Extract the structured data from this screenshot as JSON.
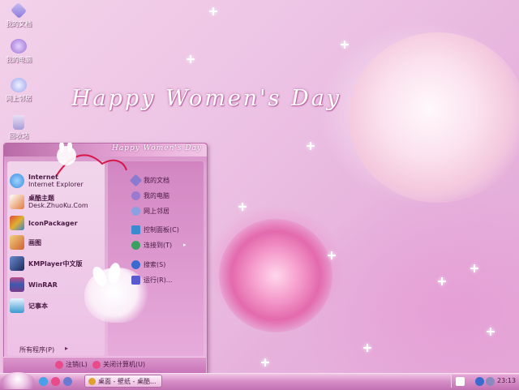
{
  "desktop": {
    "headline": "Happy Women's Day",
    "icons": [
      {
        "label": "我的文档",
        "icon": "my-documents-icon",
        "color": "#9c8ee0"
      },
      {
        "label": "我的电脑",
        "icon": "my-computer-icon",
        "color": "#b08ae0"
      },
      {
        "label": "网上邻居",
        "icon": "network-icon",
        "color": "#a9b2f2"
      },
      {
        "label": "回收站",
        "icon": "recycle-bin-icon",
        "color": "#c0b4e6"
      }
    ]
  },
  "start_menu": {
    "header_title": "Happy Women's Day",
    "left_items": [
      {
        "title": "Internet",
        "subtitle": "Internet Explorer",
        "icon": "ie-icon",
        "color": "#3a8be0"
      },
      {
        "title": "桌酷主题",
        "subtitle": "Desk.ZhuoKu.Com",
        "icon": "zhuoku-theme-icon",
        "color": "#e07a3a"
      },
      {
        "title": "IconPackager",
        "subtitle": "",
        "icon": "iconpackager-icon",
        "color": "#e0a030"
      },
      {
        "title": "画图",
        "subtitle": "",
        "icon": "paint-icon",
        "color": "#d06030"
      },
      {
        "title": "KMPlayer中文版",
        "subtitle": "",
        "icon": "kmplayer-icon",
        "color": "#2b4a8a"
      },
      {
        "title": "WinRAR",
        "subtitle": "",
        "icon": "winrar-icon",
        "color": "#7a3a8a"
      },
      {
        "title": "记事本",
        "subtitle": "",
        "icon": "notepad-icon",
        "color": "#3a9ad0"
      }
    ],
    "right_items": [
      {
        "label": "我的文档",
        "icon": "my-documents-icon",
        "color": "#8a7ad0",
        "arrow": ""
      },
      {
        "label": "我的电脑",
        "icon": "my-computer-icon",
        "color": "#9a7ad0",
        "arrow": ""
      },
      {
        "label": "网上邻居",
        "icon": "network-icon",
        "color": "#8aa0e0",
        "arrow": ""
      },
      {
        "label": "控制面板(C)",
        "icon": "control-panel-icon",
        "color": "#3a8ad0",
        "arrow": ""
      },
      {
        "label": "连接到(T)",
        "icon": "connect-to-icon",
        "color": "#3aa060",
        "arrow": "▸"
      },
      {
        "label": "搜索(S)",
        "icon": "search-icon",
        "color": "#3a6ad0",
        "arrow": ""
      },
      {
        "label": "运行(R)...",
        "icon": "run-icon",
        "color": "#5a5ad0",
        "arrow": ""
      }
    ],
    "all_programs": "所有程序(P)",
    "all_programs_arrow": "▸",
    "logoff": "注销(L)",
    "shutdown": "关闭计算机(U)"
  },
  "taskbar": {
    "task_label": "桌面 - 壁纸 - 桌酷...",
    "clock": "23:13"
  }
}
